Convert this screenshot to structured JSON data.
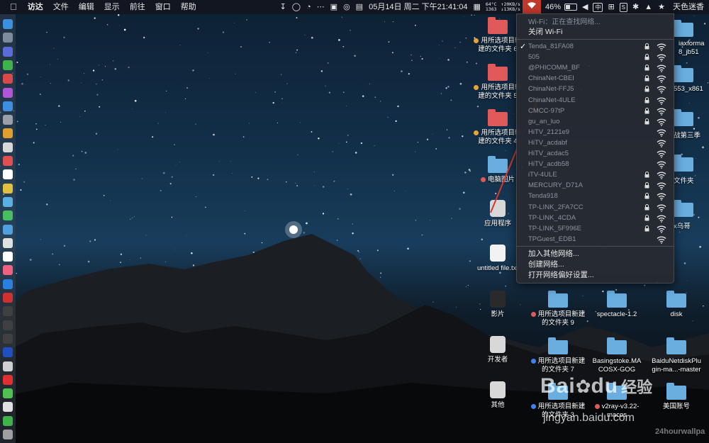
{
  "menubar": {
    "apple": "",
    "items": [
      "访达",
      "文件",
      "编辑",
      "显示",
      "前往",
      "窗口",
      "帮助"
    ],
    "net": {
      "temp": "64°C",
      "rpm": "1363",
      "up": "↑20KB/s",
      "down": "↓13KB/s"
    },
    "datetime": "05月14日 周二 下午21:41:04",
    "battery": "46%",
    "battery_level": 0.46,
    "input_method": "中",
    "box_label": "S",
    "user": "天色迷香"
  },
  "wifi_menu": {
    "status": "Wi-Fi：正在查找网络...",
    "toggle": "关闭 Wi-Fi",
    "networks": [
      {
        "name": "Tenda_81FA08",
        "locked": true,
        "checked": true
      },
      {
        "name": "505",
        "locked": true,
        "checked": false
      },
      {
        "name": "@PHICOMM_BF",
        "locked": true,
        "checked": false
      },
      {
        "name": "ChinaNet-CBEI",
        "locked": true,
        "checked": false
      },
      {
        "name": "ChinaNet-FFJ5",
        "locked": true,
        "checked": false
      },
      {
        "name": "ChinaNet-4ULE",
        "locked": true,
        "checked": false
      },
      {
        "name": "CMCC-97tP",
        "locked": true,
        "checked": false
      },
      {
        "name": "gu_an_luo",
        "locked": true,
        "checked": false
      },
      {
        "name": "HiTV_2121e9",
        "locked": false,
        "checked": false
      },
      {
        "name": "HiTV_acdabf",
        "locked": false,
        "checked": false
      },
      {
        "name": "HiTV_acdac5",
        "locked": false,
        "checked": false
      },
      {
        "name": "HiTV_acdb58",
        "locked": false,
        "checked": false
      },
      {
        "name": "iTV-4ULE",
        "locked": true,
        "checked": false
      },
      {
        "name": "MERCURY_D71A",
        "locked": true,
        "checked": false
      },
      {
        "name": "Tenda918",
        "locked": true,
        "checked": false
      },
      {
        "name": "TP-LINK_2FA7CC",
        "locked": true,
        "checked": false
      },
      {
        "name": "TP-LINK_4CDA",
        "locked": true,
        "checked": false
      },
      {
        "name": "TP-LINK_5F996E",
        "locked": true,
        "checked": false
      },
      {
        "name": "TPGuest_EDB1",
        "locked": false,
        "checked": false
      }
    ],
    "actions": [
      "加入其他网络...",
      "创建网络...",
      "打开网络偏好设置..."
    ]
  },
  "desktop": {
    "left_column": [
      {
        "label1": "用所选项目新",
        "label2": "建的文件夹 6",
        "tag": "#e8a33a",
        "folder_color": "#e05a5a"
      },
      {
        "label1": "用所选项目新",
        "label2": "建的文件夹 5",
        "tag": "#e8a33a",
        "folder_color": "#e05a5a"
      },
      {
        "label1": "用所选项目新",
        "label2": "建的文件夹 4",
        "tag": "#e8a33a",
        "folder_color": "#e05a5a"
      },
      {
        "label1": "电脑图片",
        "label2": "",
        "tag": "#e05a5a",
        "folder_color": "#6aaee0"
      },
      {
        "label1": "应用程序",
        "label2": "",
        "tag": "",
        "folder_color": ""
      },
      {
        "label1": "untitled file.txt",
        "label2": "",
        "tag": "",
        "folder_color": ""
      },
      {
        "label1": "影片",
        "label2": "",
        "tag": "",
        "folder_color": ""
      },
      {
        "label1": "开发者",
        "label2": "",
        "tag": "",
        "folder_color": ""
      },
      {
        "label1": "其他",
        "label2": "",
        "tag": "",
        "folder_color": ""
      }
    ],
    "right_partial": [
      "iaxforma",
      "8_jb51",
      "553_x861",
      "战第三季",
      "文件夹",
      "x乌哥"
    ],
    "bottom_rows": [
      {
        "label1": "用所选项目新建",
        "label2": "的文件夹 9",
        "tag": "#e05a5a"
      },
      {
        "label1": "spectacle-1.2",
        "label2": "",
        "tag": ""
      },
      {
        "label1": "disk",
        "label2": "",
        "tag": ""
      },
      {
        "label1": "用所选项目新建",
        "label2": "的文件夹 7",
        "tag": "#3b82f6"
      },
      {
        "label1": "Basingstoke.MA",
        "label2": "COSX-GOG",
        "tag": ""
      },
      {
        "label1": "BaiduNetdiskPlu",
        "label2": "gin-ma...-master",
        "tag": ""
      },
      {
        "label1": "用所选项目新建",
        "label2": "的文件夹 3",
        "tag": "#3b82f6"
      },
      {
        "label1": "v2ray-v3.22-",
        "label2": "macos",
        "tag": "#e05a5a"
      },
      {
        "label1": "美国账号",
        "label2": "",
        "tag": ""
      }
    ]
  },
  "watermark": {
    "baidu": "Bai",
    "du": "du",
    "jingyan": "经验",
    "url": "jingyan.baidu.com",
    "credit": "24hourwallpa"
  },
  "colors": {
    "accent": "#c0392b",
    "annotation_arrow": "#d9342b",
    "folder_blue": "#6aaee0",
    "folder_red": "#e05a5a"
  }
}
